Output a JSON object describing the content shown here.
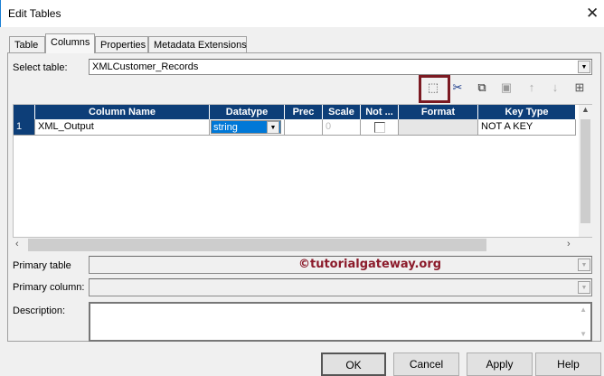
{
  "window": {
    "title": "Edit Tables"
  },
  "tabs": [
    "Table",
    "Columns",
    "Properties",
    "Metadata Extensions"
  ],
  "select_table": {
    "label": "Select table:",
    "value": "XMLCustomer_Records"
  },
  "toolbar": [
    "new-column",
    "cut",
    "copy",
    "paste",
    "move-up",
    "move-down",
    "import-fields"
  ],
  "grid": {
    "headers": [
      "Column Name",
      "Datatype",
      "Prec",
      "Scale",
      "Not ...",
      "Format",
      "Key Type"
    ],
    "rows": [
      {
        "num": "1",
        "name": "XML_Output",
        "datatype": "string",
        "prec": "",
        "scale": "0",
        "not_null": false,
        "format": "",
        "key_type": "NOT A KEY"
      }
    ]
  },
  "primary_table": {
    "label": "Primary table",
    "value": ""
  },
  "primary_column": {
    "label": "Primary column:",
    "value": ""
  },
  "description": {
    "label": "Description:",
    "value": ""
  },
  "watermark": "©tutorialgateway.org",
  "buttons": {
    "ok": "OK",
    "cancel": "Cancel",
    "apply": "Apply",
    "help": "Help"
  }
}
